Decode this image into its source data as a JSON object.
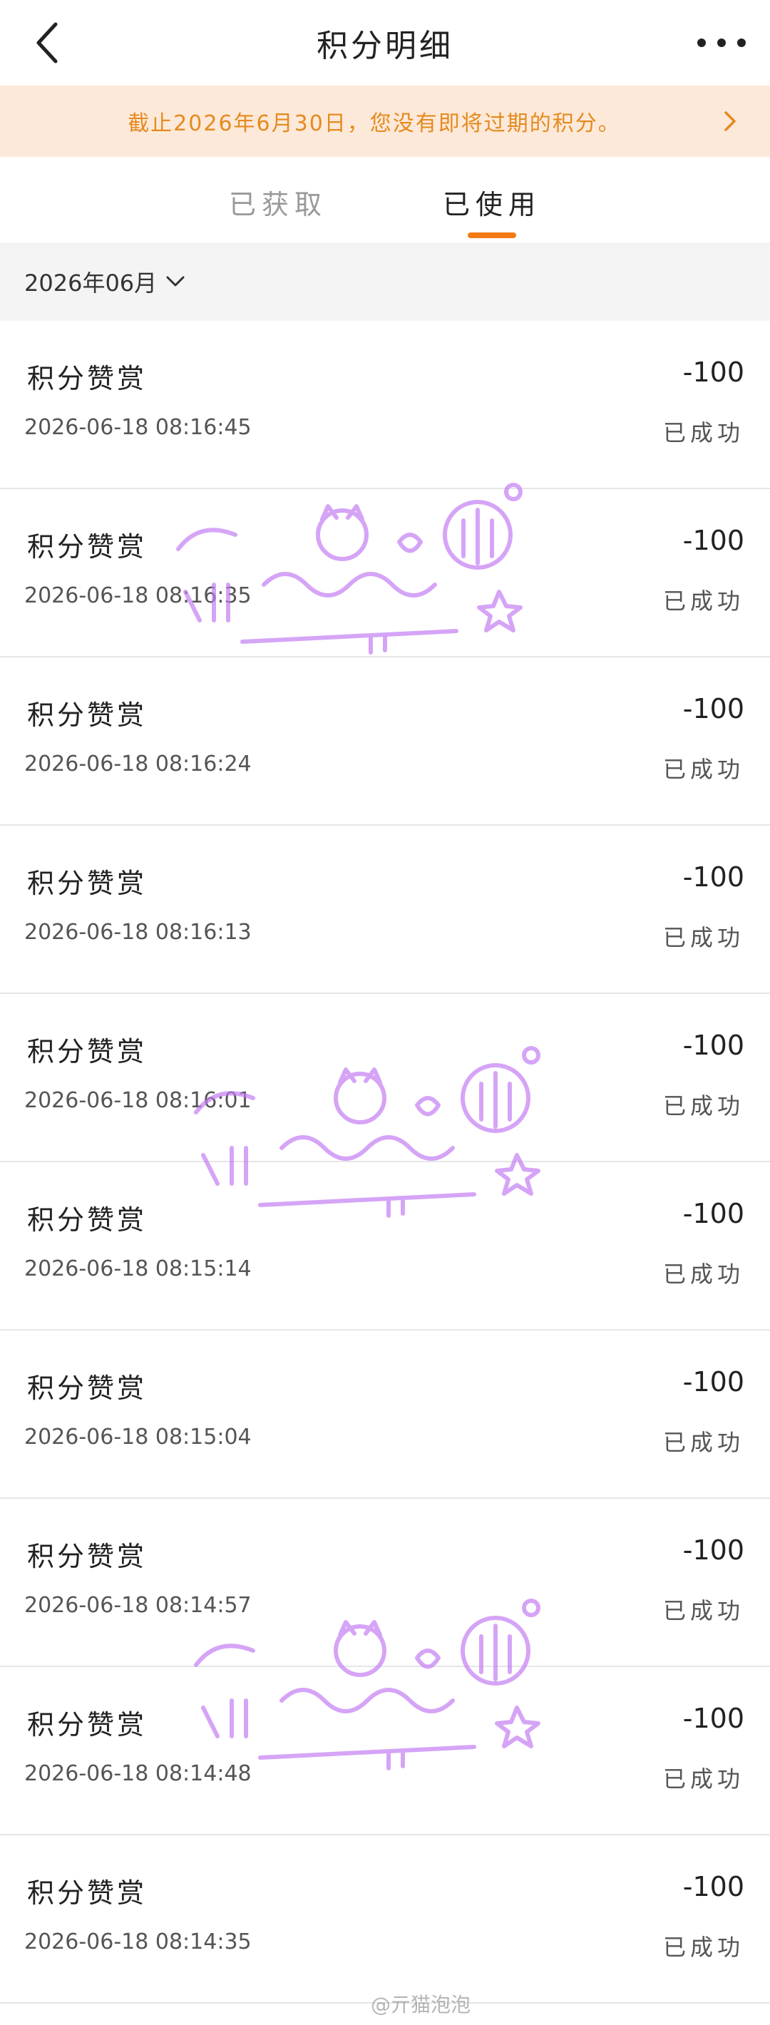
{
  "header": {
    "title": "积分明细",
    "back_icon": "chevron-left-icon",
    "more_icon": "more-dots-icon"
  },
  "notice": {
    "text": "截止2026年6月30日，您没有即将过期的积分。",
    "color": "#e58a1f",
    "background": "#fde9d9"
  },
  "tabs": [
    {
      "label": "已获取",
      "active": false
    },
    {
      "label": "已使用",
      "active": true
    }
  ],
  "accent_color": "#f27a16",
  "filter": {
    "month_label": "2026年06月"
  },
  "records": [
    {
      "title": "积分赞赏",
      "time": "2026-06-18 08:16:45",
      "amount": "-100",
      "status": "已成功"
    },
    {
      "title": "积分赞赏",
      "time": "2026-06-18 08:16:35",
      "amount": "-100",
      "status": "已成功"
    },
    {
      "title": "积分赞赏",
      "time": "2026-06-18 08:16:24",
      "amount": "-100",
      "status": "已成功"
    },
    {
      "title": "积分赞赏",
      "time": "2026-06-18 08:16:13",
      "amount": "-100",
      "status": "已成功"
    },
    {
      "title": "积分赞赏",
      "time": "2026-06-18 08:16:01",
      "amount": "-100",
      "status": "已成功"
    },
    {
      "title": "积分赞赏",
      "time": "2026-06-18 08:15:14",
      "amount": "-100",
      "status": "已成功"
    },
    {
      "title": "积分赞赏",
      "time": "2026-06-18 08:15:04",
      "amount": "-100",
      "status": "已成功"
    },
    {
      "title": "积分赞赏",
      "time": "2026-06-18 08:14:57",
      "amount": "-100",
      "status": "已成功"
    },
    {
      "title": "积分赞赏",
      "time": "2026-06-18 08:14:48",
      "amount": "-100",
      "status": "已成功"
    },
    {
      "title": "积分赞赏",
      "time": "2026-06-18 08:14:35",
      "amount": "-100",
      "status": "已成功"
    }
  ],
  "watermark": {
    "stamp_color": "#b96af0",
    "corner_text": "@亓猫泡泡"
  }
}
